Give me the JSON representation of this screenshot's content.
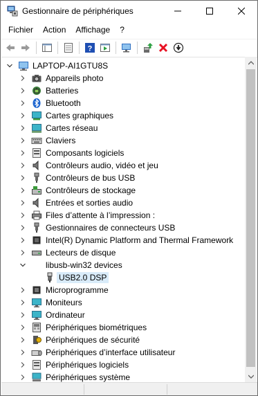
{
  "window": {
    "title": "Gestionnaire de périphériques"
  },
  "menu": {
    "items": [
      "Fichier",
      "Action",
      "Affichage",
      "?"
    ]
  },
  "toolbar": {
    "buttons": [
      "back-arrow-icon",
      "forward-arrow-icon",
      "show-hide-console-tree-icon",
      "properties-icon",
      "help-icon",
      "run-icon",
      "scan-hardware-changes-icon",
      "update-driver-icon",
      "uninstall-device-icon",
      "disable-device-icon"
    ],
    "accent_colors": {
      "help": "#1f4fb3",
      "delete": "#e81123",
      "update": "#2ea043"
    }
  },
  "tree": {
    "root": "LAPTOP-AI1GTU8S",
    "items": [
      {
        "label": "Appareils photo",
        "icon": "camera-icon"
      },
      {
        "label": "Batteries",
        "icon": "battery-icon"
      },
      {
        "label": "Bluetooth",
        "icon": "bluetooth-icon"
      },
      {
        "label": "Cartes graphiques",
        "icon": "display-adapter-icon"
      },
      {
        "label": "Cartes réseau",
        "icon": "network-adapter-icon"
      },
      {
        "label": "Claviers",
        "icon": "keyboard-icon"
      },
      {
        "label": "Composants logiciels",
        "icon": "software-component-icon"
      },
      {
        "label": "Contrôleurs audio, vidéo et jeu",
        "icon": "speaker-icon"
      },
      {
        "label": "Contrôleurs de bus USB",
        "icon": "usb-icon"
      },
      {
        "label": "Contrôleurs de stockage",
        "icon": "storage-controller-icon"
      },
      {
        "label": "Entrées et sorties audio",
        "icon": "audio-io-icon"
      },
      {
        "label": "Files d’attente à l’impression :",
        "icon": "printer-queue-icon"
      },
      {
        "label": "Gestionnaires de connecteurs USB",
        "icon": "usb-connector-icon"
      },
      {
        "label": "Intel(R) Dynamic Platform and Thermal Framework",
        "icon": "chip-icon"
      },
      {
        "label": "Lecteurs de disque",
        "icon": "disk-drive-icon"
      },
      {
        "label": "libusb-win32 devices",
        "icon": "usb-device-icon",
        "expanded": true
      },
      {
        "label": "Microprogramme",
        "icon": "firmware-icon"
      },
      {
        "label": "Moniteurs",
        "icon": "monitor-icon"
      },
      {
        "label": "Ordinateur",
        "icon": "computer-icon"
      },
      {
        "label": "Périphériques biométriques",
        "icon": "biometric-icon"
      },
      {
        "label": "Périphériques de sécurité",
        "icon": "security-device-icon"
      },
      {
        "label": "Périphériques d’interface utilisateur",
        "icon": "hid-icon"
      },
      {
        "label": "Périphériques logiciels",
        "icon": "software-device-icon"
      },
      {
        "label": "Périphériques système",
        "icon": "system-device-icon"
      }
    ],
    "child_of_libusb": {
      "label": "USB2.0 DSP",
      "icon": "usb-plug-icon",
      "selected": true
    }
  }
}
